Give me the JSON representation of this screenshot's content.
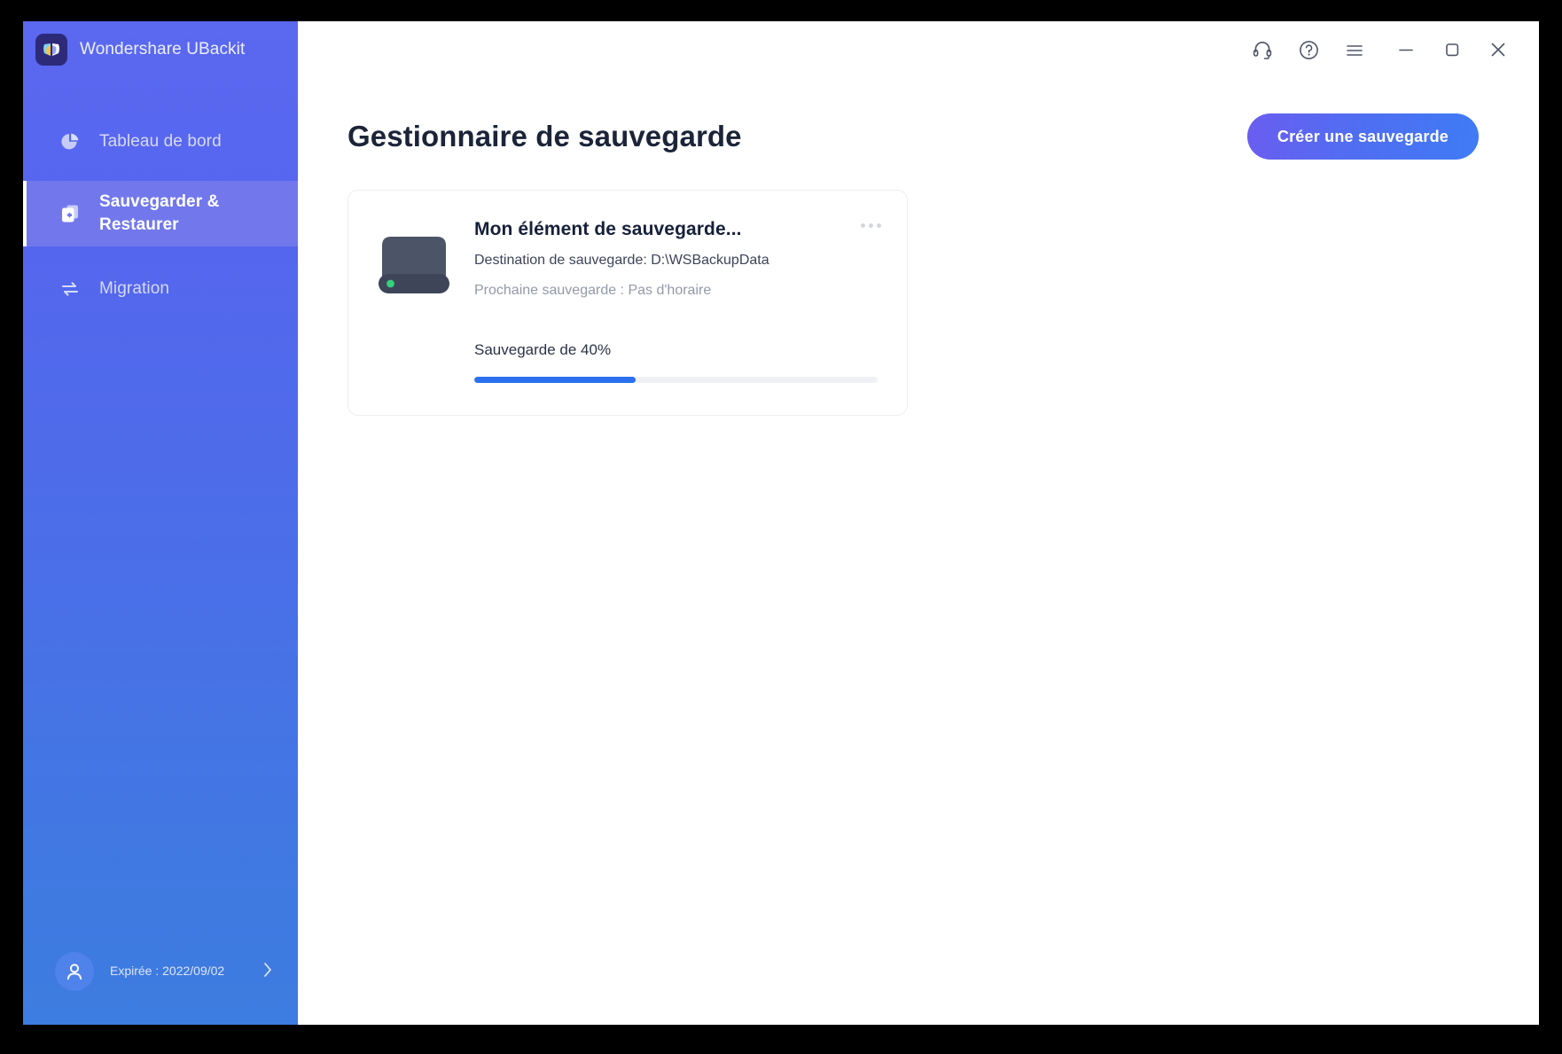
{
  "app": {
    "brand_name": "Wondershare UBackit",
    "brand_logo_icon": "butterfly-logo-icon"
  },
  "sidebar": {
    "items": [
      {
        "id": "dashboard",
        "label": "Tableau de bord",
        "icon": "pie-chart-icon",
        "active": false
      },
      {
        "id": "backup-restore",
        "label": "Sauvegarder & Restaurer",
        "icon": "backup-restore-icon",
        "active": true
      },
      {
        "id": "migration",
        "label": "Migration",
        "icon": "transfer-arrows-icon",
        "active": false
      }
    ],
    "account": {
      "avatar_icon": "user-avatar-icon",
      "name_redacted": true,
      "expiry": "Expirée : 2022/09/02",
      "chevron_icon": "chevron-right-icon"
    }
  },
  "titlebar": {
    "buttons": [
      {
        "id": "support",
        "icon": "headset-icon"
      },
      {
        "id": "help",
        "icon": "question-circle-icon"
      },
      {
        "id": "menu",
        "icon": "hamburger-menu-icon"
      },
      {
        "id": "minimize",
        "icon": "minimize-icon"
      },
      {
        "id": "maximize",
        "icon": "maximize-icon"
      },
      {
        "id": "close",
        "icon": "close-icon"
      }
    ]
  },
  "main": {
    "page_title": "Gestionnaire de sauvegarde",
    "create_backup_label": "Créer une sauvegarde"
  },
  "backup_card": {
    "drive_icon": "external-hard-drive-icon",
    "title": "Mon élément de sauvegarde...",
    "destination": "Destination de sauvegarde: D:\\WSBackupData",
    "next_backup": "Prochaine sauvegarde : Pas d'horaire",
    "menu_icon": "more-options-icon",
    "progress_label": "Sauvegarde de 40%",
    "progress_percent": 40,
    "progress_width": "40%"
  },
  "colors": {
    "sidebar_top": "#5b68f0",
    "sidebar_bottom": "#3d7ce0",
    "active_nav": "#7278ec",
    "accent_button_start": "#6a5df0",
    "accent_button_end": "#3f7bf5",
    "progress_fill": "#2b71ef",
    "progress_track": "#eef0f3",
    "drive_body": "#4c5468",
    "drive_led": "#34d17a"
  }
}
